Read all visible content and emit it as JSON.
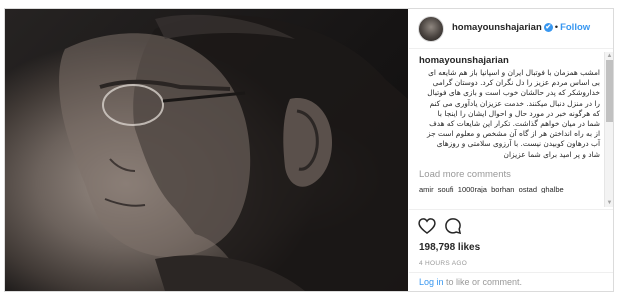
{
  "post": {
    "username": "homayounshajarian",
    "verified_badge": "✔",
    "separator": "•",
    "follow_label": "Follow",
    "caption_username": "homayounshajarian",
    "caption": "امشب همزمان با فوتبال ایران و اسپانیا باز هم شایعه ای\nبی اساس مردم عزیز را دل نگران کرد. دوستان گرامی\nخداروشکر که پدر حالشان خوب است و بازی های فوتبال\nرا در منزل دنبال میکنند. خدمت عزیزان یادآوری می کنم\nکه هرگونه خبر در مورد حال و احوال ایشان را اینجا با\nشما در میان خواهم گذاشت. تکرار این شایعات که هدف\nاز به راه انداختن هر از گاه آن مشخص و معلوم است جز\nآب درهاون کوبیدن نیست. با آرزوی سلامتی و روزهای\nشاد و پر امید برای شما عزیزان",
    "load_more_label": "Load more comments",
    "next_comment": "amir_soufi_1000raja_borhan_ostad_ghalbe",
    "likes": "198,798 likes",
    "timestamp": "4 HOURS AGO",
    "login_link": "Log in",
    "login_rest": " to like or comment."
  },
  "icons": {
    "heart": "heart-outline-icon",
    "comment": "comment-bubble-icon",
    "verified": "verified-badge-icon"
  },
  "colors": {
    "accent": "#3897f0",
    "text": "#262626",
    "muted": "#999999",
    "border": "#dbdbdb"
  }
}
